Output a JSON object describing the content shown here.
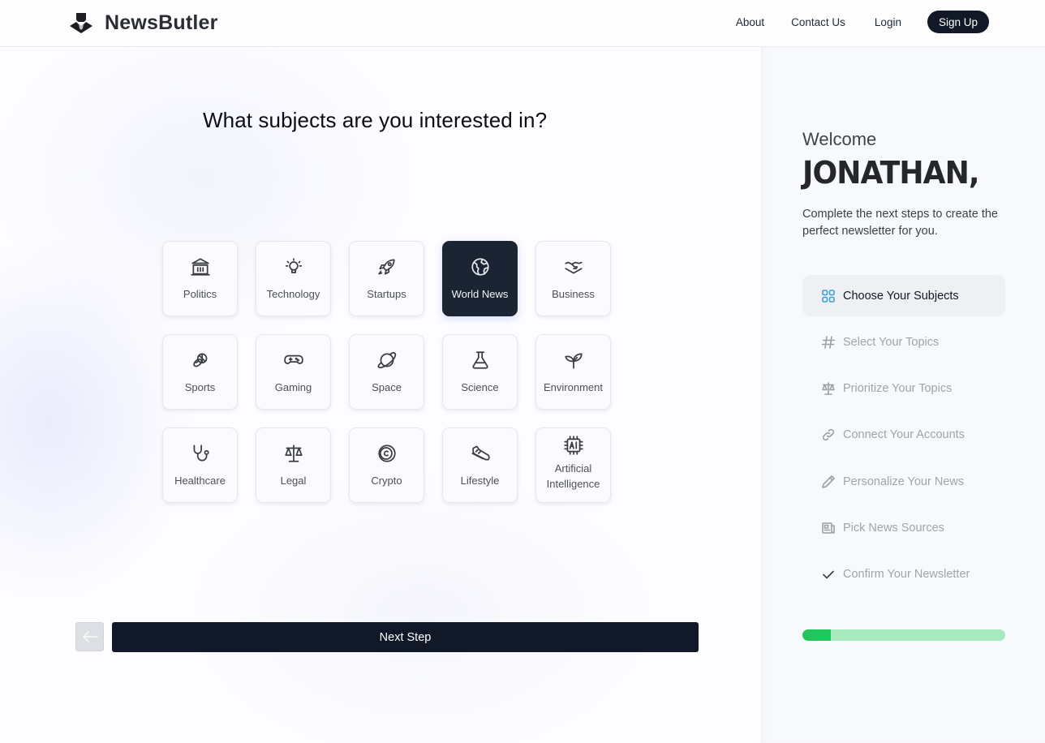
{
  "header": {
    "brand": "NewsButler",
    "logo_icon": "butler-icon",
    "nav": {
      "about": "About",
      "contact": "Contact Us",
      "login": "Login",
      "signup": "Sign Up"
    }
  },
  "main": {
    "question": "What subjects are you interested in?",
    "subjects": [
      {
        "label": "Politics",
        "icon": "capitol-building-icon",
        "selected": false
      },
      {
        "label": "Technology",
        "icon": "lightbulb-icon",
        "selected": false
      },
      {
        "label": "Startups",
        "icon": "rocket-icon",
        "selected": false
      },
      {
        "label": "World News",
        "icon": "globe-icon",
        "selected": true
      },
      {
        "label": "Business",
        "icon": "handshake-icon",
        "selected": false
      },
      {
        "label": "Sports",
        "icon": "sports-balls-icon",
        "selected": false
      },
      {
        "label": "Gaming",
        "icon": "gamepad-icon",
        "selected": false
      },
      {
        "label": "Space",
        "icon": "planet-icon",
        "selected": false
      },
      {
        "label": "Science",
        "icon": "flask-icon",
        "selected": false
      },
      {
        "label": "Environment",
        "icon": "sprout-icon",
        "selected": false
      },
      {
        "label": "Healthcare",
        "icon": "stethoscope-icon",
        "selected": false
      },
      {
        "label": "Legal",
        "icon": "scale-icon",
        "selected": false
      },
      {
        "label": "Crypto",
        "icon": "coin-icon",
        "selected": false
      },
      {
        "label": "Lifestyle",
        "icon": "sneaker-icon",
        "selected": false
      },
      {
        "label": "Artificial Intelligence",
        "icon": "ai-chip-icon",
        "selected": false
      }
    ],
    "back_icon": "arrow-left-icon",
    "next_label": "Next Step"
  },
  "sidebar": {
    "welcome": "Welcome",
    "name": "JONATHAN,",
    "intro": "Complete the next steps to create the perfect newsletter for you.",
    "steps": [
      {
        "label": "Choose Your Subjects",
        "icon": "grid-icon",
        "state": "active"
      },
      {
        "label": "Select Your Topics",
        "icon": "hash-icon",
        "state": "pending"
      },
      {
        "label": "Prioritize Your Topics",
        "icon": "scale-icon",
        "state": "pending"
      },
      {
        "label": "Connect Your Accounts",
        "icon": "link-icon",
        "state": "pending"
      },
      {
        "label": "Personalize Your News",
        "icon": "pencil-icon",
        "state": "pending"
      },
      {
        "label": "Pick News Sources",
        "icon": "newspaper-icon",
        "state": "pending"
      },
      {
        "label": "Confirm Your Newsletter",
        "icon": "check-icon",
        "state": "pending"
      }
    ],
    "progress_percent": 14,
    "colors": {
      "progress_fill": "#22c55e",
      "progress_track": "#a7eac0",
      "active_step_icon": "#38a3d6",
      "primary_dark": "#111827"
    }
  }
}
